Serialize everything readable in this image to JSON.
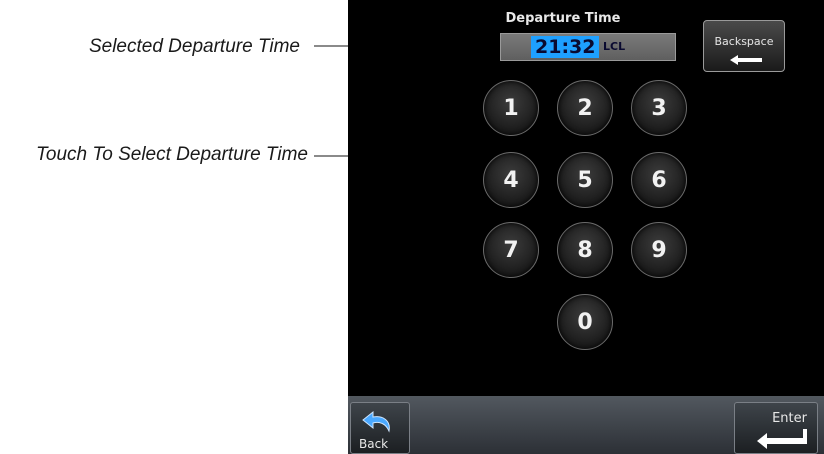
{
  "callouts": {
    "selected_time": "Selected Departure Time",
    "touch_select": "Touch To Select Departure Time"
  },
  "screen": {
    "title": "Departure Time",
    "time_value": "21:32",
    "time_unit": "LCL",
    "backspace_label": "Backspace",
    "keypad": [
      "1",
      "2",
      "3",
      "4",
      "5",
      "6",
      "7",
      "8",
      "9",
      "0"
    ],
    "back_label": "Back",
    "enter_label": "Enter"
  },
  "colors": {
    "screen_bg": "#000000",
    "time_highlight": "#1ea0ff",
    "bar_bg": "#3c4148"
  },
  "icons": {
    "backspace": "left-arrow-icon",
    "back": "back-curved-arrow-icon",
    "enter": "enter-return-icon"
  }
}
